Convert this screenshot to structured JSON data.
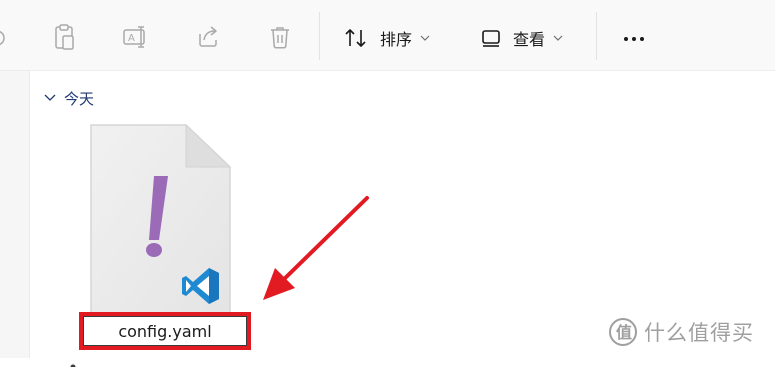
{
  "toolbar": {
    "icons": [
      "new-icon",
      "paste-icon",
      "rename-icon",
      "share-icon",
      "delete-icon"
    ],
    "sort_label": "排序",
    "view_label": "查看"
  },
  "group": {
    "label": "今天"
  },
  "file": {
    "name": "config.yaml",
    "icon": "yaml-file-icon",
    "badge": "vscode-badge-icon"
  },
  "watermark": {
    "text": "什么值得买"
  },
  "colors": {
    "toolbar_bg": "#f9f9f9",
    "group_header": "#1e3a72",
    "highlight_red": "#e21b23",
    "yaml_purple": "#9b6bb7",
    "vscode_blue": "#1f8ad2"
  }
}
